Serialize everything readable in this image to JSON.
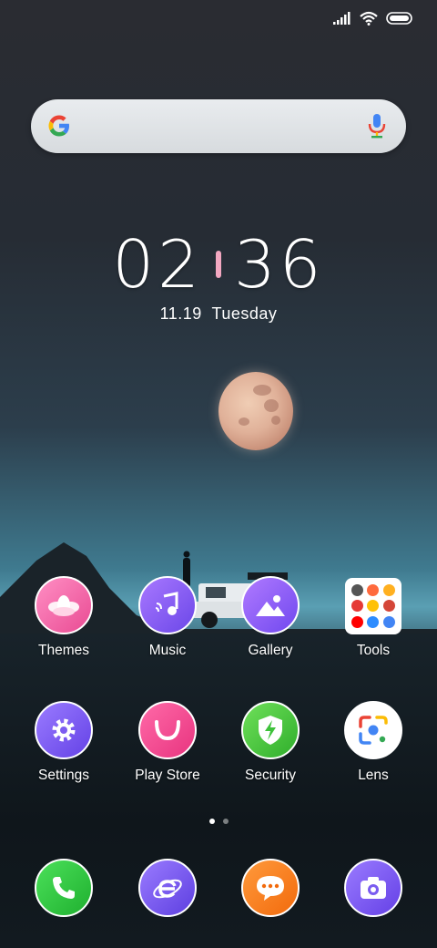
{
  "search": {
    "icon_left": "google-g-icon",
    "icon_right": "mic-icon"
  },
  "clock": {
    "hours": "02",
    "minutes": "36",
    "date": "11.19",
    "day": "Tuesday"
  },
  "apps_row1": [
    {
      "label": "Themes",
      "icon": "flower-icon",
      "color": "#f06ba8"
    },
    {
      "label": "Music",
      "icon": "music-note-icon",
      "color": "#8c63f2"
    },
    {
      "label": "Gallery",
      "icon": "mountain-image-icon",
      "color": "#8a5cf5"
    },
    {
      "label": "Tools",
      "icon": "folder-grid-icon",
      "color": "#ffffff"
    }
  ],
  "apps_row2": [
    {
      "label": "Settings",
      "icon": "gear-icon",
      "color": "#7c5cf0"
    },
    {
      "label": "Play Store",
      "icon": "bag-handle-icon",
      "color": "#f0458f"
    },
    {
      "label": "Security",
      "icon": "shield-bolt-icon",
      "color": "#3ec23a"
    },
    {
      "label": "Lens",
      "icon": "lens-icon",
      "color": "#ffffff"
    }
  ],
  "dock": [
    {
      "icon": "phone-icon",
      "color": "#2ecc40"
    },
    {
      "icon": "browser-e-icon",
      "color": "#7a5cf0"
    },
    {
      "icon": "message-bubble-icon",
      "color": "#ff7a1a"
    },
    {
      "icon": "camera-icon",
      "color": "#7a5cf0"
    }
  ],
  "page_indicator": {
    "current": 1,
    "total": 2
  }
}
